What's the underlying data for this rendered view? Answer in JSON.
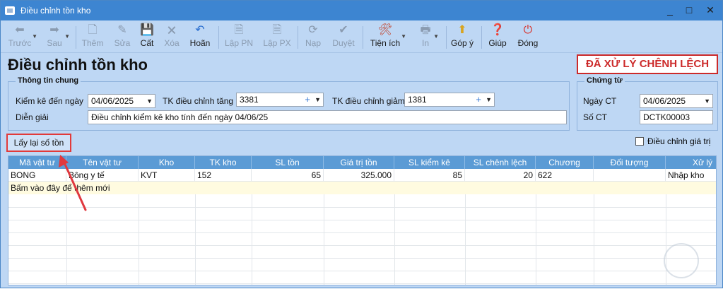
{
  "window": {
    "title": "Điều chỉnh tồn kho",
    "minimize": "_",
    "maximize": "□",
    "close": "✕"
  },
  "toolbar": {
    "prev": "Trước",
    "next": "Sau",
    "add": "Thêm",
    "edit": "Sửa",
    "save": "Cất",
    "delete": "Xóa",
    "undo": "Hoãn",
    "create_receipt": "Lập PN",
    "create_issue": "Lập PX",
    "reload": "Nạp",
    "approve": "Duyệt",
    "utilities": "Tiện ích",
    "print": "In",
    "feedback": "Góp ý",
    "help": "Giúp",
    "close": "Đóng"
  },
  "page": {
    "title": "Điều chỉnh tồn kho",
    "status": "ĐÃ XỬ LÝ CHÊNH LỆCH"
  },
  "general": {
    "title": "Thông tin chung",
    "inventory_to_label": "Kiểm kê đến ngày",
    "inventory_to_value": "04/06/2025",
    "acct_increase_label": "TK điều chỉnh tăng",
    "acct_increase_value": "3381",
    "acct_decrease_label": "TK điều chỉnh giảm",
    "acct_decrease_value": "1381",
    "description_label": "Diễn giải",
    "description_value": "Điều chỉnh kiểm kê kho tính đến ngày 04/06/25"
  },
  "voucher": {
    "title": "Chứng từ",
    "date_label": "Ngày CT",
    "date_value": "04/06/2025",
    "number_label": "Số CT",
    "number_value": "DCTK00003"
  },
  "actions": {
    "refresh_stock": "Lấy lại số tồn",
    "adjust_value": "Điều chỉnh giá trị"
  },
  "grid": {
    "columns": [
      "Mã vật tư",
      "Tên vật tư",
      "Kho",
      "TK kho",
      "SL tồn",
      "Giá trị tồn",
      "SL kiểm kê",
      "SL chênh lệch",
      "Chương",
      "Đối tượng",
      "Xử lý"
    ],
    "rows": [
      [
        "BONG",
        "Bông y tế",
        "KVT",
        "152",
        "65",
        "325.000",
        "85",
        "20",
        "622",
        "",
        "Nhập kho"
      ]
    ],
    "add_row_hint": "Bấm vào đây để thêm mới"
  },
  "colors": {
    "titlebar": "#3d85d1",
    "background": "#bed7f4",
    "accent_red": "#cc2a2a",
    "grid_header": "#5b9bd5"
  }
}
